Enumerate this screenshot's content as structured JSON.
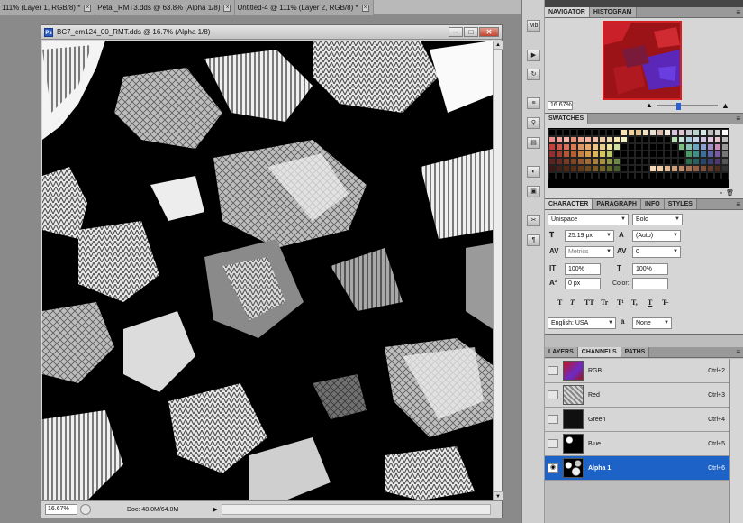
{
  "doc_tabs": [
    {
      "label": "111% (Layer 1, RGB/8) *"
    },
    {
      "label": "Petal_RMT3.dds @ 63.8% (Alpha 1/8)"
    },
    {
      "label": "Untitled-4 @ 111% (Layer 2, RGB/8) *"
    }
  ],
  "document": {
    "title": "BC7_em124_00_RMT.dds @ 16.7% (Alpha 1/8)",
    "app_icon": "Ps",
    "zoom": "16.67%",
    "doc_size": "Doc: 48.0M/64.0M",
    "minimize": "–",
    "maximize": "□",
    "close": "✕"
  },
  "navigator": {
    "tabs": [
      "NAVIGATOR",
      "HISTOGRAM"
    ],
    "zoom": "16.67%",
    "slider_value": 0.35
  },
  "swatches": {
    "tab": "SWATCHES",
    "colors": [
      "#000000",
      "#000000",
      "#000000",
      "#000000",
      "#000000",
      "#000000",
      "#000000",
      "#000000",
      "#000000",
      "#000000",
      "#f7e3b4",
      "#f3d19a",
      "#e2c393",
      "#f2e2c6",
      "#e9dcd0",
      "#d9b7a9",
      "#f7ecdf",
      "#d8c2e0",
      "#e0c4d2",
      "#c8c8d0",
      "#b9d5c9",
      "#d7e8e9",
      "#bdbdbd",
      "#d4d4d4",
      "#ffffff",
      "#e8908b",
      "#f0a39c",
      "#f6b6a9",
      "#e78f77",
      "#f0a892",
      "#f4b6a1",
      "#f0c0a9",
      "#f1cda7",
      "#efdab3",
      "#f7e7b0",
      "#f3f0c5",
      "#000000",
      "#000000",
      "#000000",
      "#000000",
      "#000000",
      "#000000",
      "#b6e0b3",
      "#c6e1d6",
      "#a8ccd8",
      "#c7d3e7",
      "#d0c4e1",
      "#e2c9de",
      "#e7c7cf",
      "#bfbfbf",
      "#c2403e",
      "#d15a4e",
      "#db7260",
      "#d97a51",
      "#e19566",
      "#e9a96c",
      "#eec387",
      "#e7d18b",
      "#efe39d",
      "#cfe0a0",
      "#000000",
      "#000000",
      "#000000",
      "#000000",
      "#000000",
      "#000000",
      "#000000",
      "#000000",
      "#7fbf86",
      "#84c1b2",
      "#6fa4c0",
      "#8e9fd1",
      "#a38ec7",
      "#c98fb6",
      "#9a9a9a",
      "#8e2f30",
      "#a13c33",
      "#b35737",
      "#b65d2f",
      "#c77e3f",
      "#d4994a",
      "#ddb55b",
      "#d6c65e",
      "#bcc46c",
      "#000000",
      "#000000",
      "#000000",
      "#000000",
      "#000000",
      "#000000",
      "#000000",
      "#000000",
      "#000000",
      "#000000",
      "#4d9a66",
      "#3f8f88",
      "#3c6f99",
      "#5b64a6",
      "#7a5aa0",
      "#777777",
      "#5b2522",
      "#6b2b25",
      "#7c3a25",
      "#834321",
      "#94582a",
      "#9f6c31",
      "#a9833d",
      "#a7923d",
      "#8f9944",
      "#6d8b46",
      "#000000",
      "#000000",
      "#000000",
      "#000000",
      "#000000",
      "#000000",
      "#000000",
      "#000000",
      "#000000",
      "#2d6b4a",
      "#27605f",
      "#25486c",
      "#393f75",
      "#4e3a6f",
      "#555555",
      "#3a1715",
      "#46201a",
      "#512716",
      "#5a2d14",
      "#663b18",
      "#70491d",
      "#7a5a25",
      "#786625",
      "#626b2a",
      "#485f2c",
      "#000000",
      "#000000",
      "#000000",
      "#000000",
      "#f4d8b8",
      "#eecda6",
      "#e1b890",
      "#cfa07a",
      "#bd8966",
      "#aa7354",
      "#976046",
      "#7f4d38",
      "#663c2c",
      "#4f2c20",
      "#333333",
      "#000000",
      "#000000",
      "#000000",
      "#000000",
      "#000000",
      "#000000",
      "#000000",
      "#000000",
      "#000000",
      "#000000",
      "#000000",
      "#000000",
      "#000000",
      "#000000",
      "#000000",
      "#000000",
      "#000000",
      "#000000",
      "#000000",
      "#000000",
      "#000000",
      "#000000",
      "#000000",
      "#000000",
      "#000000"
    ]
  },
  "character": {
    "tabs": [
      "CHARACTER",
      "PARAGRAPH",
      "INFO",
      "STYLES"
    ],
    "font_family": "Unispace",
    "font_style": "Bold",
    "font_size": "25.19 px",
    "leading": "(Auto)",
    "kerning": "Metrics",
    "tracking": "0",
    "vertical_scale": "100%",
    "horizontal_scale": "100%",
    "baseline_shift": "0 px",
    "color_label": "Color:",
    "type_buttons": [
      "T",
      "T",
      "TT",
      "Tr",
      "T¹",
      "T,",
      "T",
      "T̶"
    ],
    "language": "English: USA",
    "anti_alias_icon": "a",
    "anti_alias": "None"
  },
  "layers": {
    "tabs": [
      "LAYERS",
      "CHANNELS",
      "PATHS"
    ],
    "channels": [
      {
        "name": "RGB",
        "shortcut": "Ctrl+2",
        "visible": false,
        "selected": false,
        "thumb": "rgb"
      },
      {
        "name": "Red",
        "shortcut": "Ctrl+3",
        "visible": false,
        "selected": false,
        "thumb": "red"
      },
      {
        "name": "Green",
        "shortcut": "Ctrl+4",
        "visible": false,
        "selected": false,
        "thumb": "green"
      },
      {
        "name": "Blue",
        "shortcut": "Ctrl+5",
        "visible": false,
        "selected": false,
        "thumb": "blue"
      },
      {
        "name": "Alpha 1",
        "shortcut": "Ctrl+6",
        "visible": true,
        "selected": true,
        "thumb": "alpha"
      }
    ]
  },
  "dock_icons": [
    "mb-icon",
    "play-icon",
    "history-icon",
    "brush-settings-icon",
    "clone-source-icon",
    "tool-presets-icon",
    "color-icon",
    "masks-icon",
    "character-icon",
    "paragraph-icon"
  ],
  "colors": {
    "selection_blue": "#1d63c7",
    "panel_gray": "#d6d6d6",
    "navigator_frame": "#d32020"
  }
}
